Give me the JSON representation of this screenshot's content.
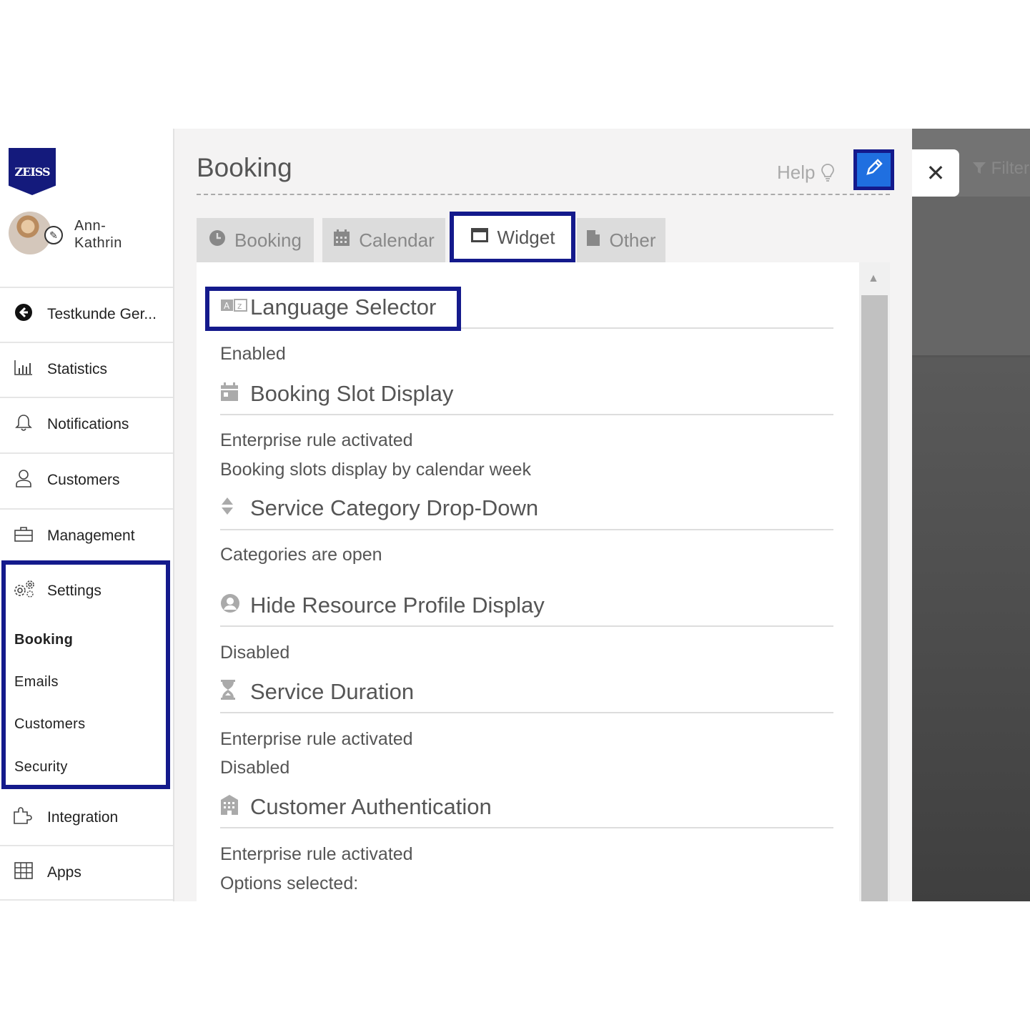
{
  "brand": {
    "logo_text": "ZEISS",
    "color": "#141a7c"
  },
  "user": {
    "name": "Ann-\nKathrin"
  },
  "sidebar": {
    "items": [
      {
        "label": "Testkunde Ger...",
        "icon": "back-arrow-icon"
      },
      {
        "label": "Statistics",
        "icon": "bar-chart-icon"
      },
      {
        "label": "Notifications",
        "icon": "bell-icon"
      },
      {
        "label": "Customers",
        "icon": "user-icon"
      },
      {
        "label": "Management",
        "icon": "briefcase-icon"
      },
      {
        "label": "Settings",
        "icon": "gears-icon"
      },
      {
        "label": "Integration",
        "icon": "puzzle-icon"
      },
      {
        "label": "Apps",
        "icon": "grid-icon"
      }
    ],
    "settings_sub": [
      "Booking",
      "Emails",
      "Customers",
      "Security"
    ],
    "active_sub": "Booking"
  },
  "header": {
    "title": "Booking",
    "help_label": "Help"
  },
  "tabs": [
    {
      "label": "Booking",
      "icon": "clock-icon"
    },
    {
      "label": "Calendar",
      "icon": "calendar-icon"
    },
    {
      "label": "Widget",
      "icon": "window-icon",
      "active": true
    },
    {
      "label": "Other",
      "icon": "file-icon"
    }
  ],
  "sections": [
    {
      "title": "Language Selector",
      "icon": "language-icon",
      "lines": [
        "Enabled"
      ]
    },
    {
      "title": "Booking Slot Display",
      "icon": "calendar-icon",
      "lines": [
        "Enterprise rule activated",
        "Booking slots display by calendar week"
      ]
    },
    {
      "title": "Service Category Drop-Down",
      "icon": "sort-icon",
      "lines": [
        "Categories are open"
      ]
    },
    {
      "title": "Hide Resource Profile Display",
      "icon": "user-circle-icon",
      "lines": [
        "Disabled"
      ]
    },
    {
      "title": "Service Duration",
      "icon": "hourglass-icon",
      "lines": [
        "Enterprise rule activated",
        "Disabled"
      ]
    },
    {
      "title": "Customer Authentication",
      "icon": "building-icon",
      "lines": [
        "Enterprise rule activated",
        "Options selected:"
      ]
    }
  ],
  "overlay": {
    "close_label": "✕",
    "filter_label": "Filter"
  },
  "colors": {
    "highlight": "#141a8c",
    "edit_button": "#1f6fe0"
  }
}
